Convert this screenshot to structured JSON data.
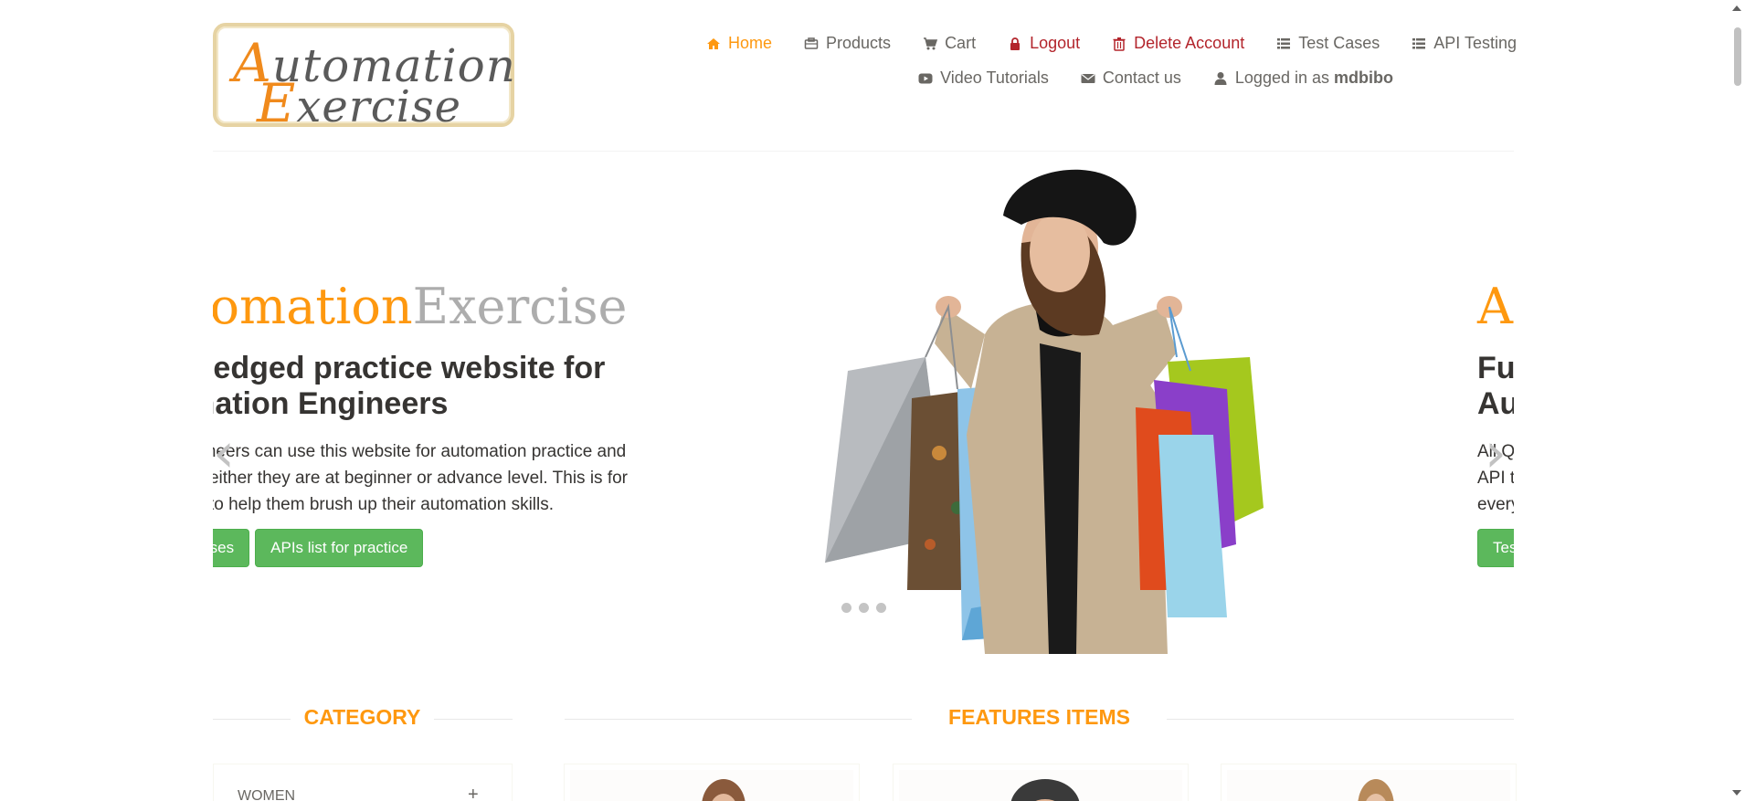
{
  "logo": {
    "line1_cap": "A",
    "line1_rest": "utomation",
    "line2_cap": "E",
    "line2_rest": "xercise"
  },
  "nav": {
    "home": "Home",
    "products": "Products",
    "cart": "Cart",
    "logout": "Logout",
    "delete_account": "Delete Account",
    "test_cases": "Test Cases",
    "api_testing": "API Testing",
    "video_tutorials": "Video Tutorials",
    "contact_us": "Contact us",
    "logged_in_prefix": "Logged in as",
    "username": "mdbibo"
  },
  "slider": {
    "brand_a": "utomation",
    "brand_b": "Exercise",
    "headline": "ll-Fledged practice website for tomation Engineers",
    "description": "A engineers can use this website for automation practice and esting either they are at beginner or advance level. This is for ybody to help them brush up their automation skills.",
    "btn_test_cases": "st Cases",
    "btn_apis": "APIs list for practice",
    "next_brand": "A",
    "next_headline": "Fu Au",
    "next_desc": "All Q API t every",
    "next_btn": "Tes",
    "prev_arrow": "‹",
    "next_arrow": "›"
  },
  "sections": {
    "category": "CATEGORY",
    "features": "FEATURES ITEMS"
  },
  "category": {
    "first_item": "WOMEN",
    "expand": "+"
  },
  "colors": {
    "accent": "#fe980f",
    "danger": "#b3252c",
    "button": "#5cb85c",
    "text": "#696763"
  }
}
